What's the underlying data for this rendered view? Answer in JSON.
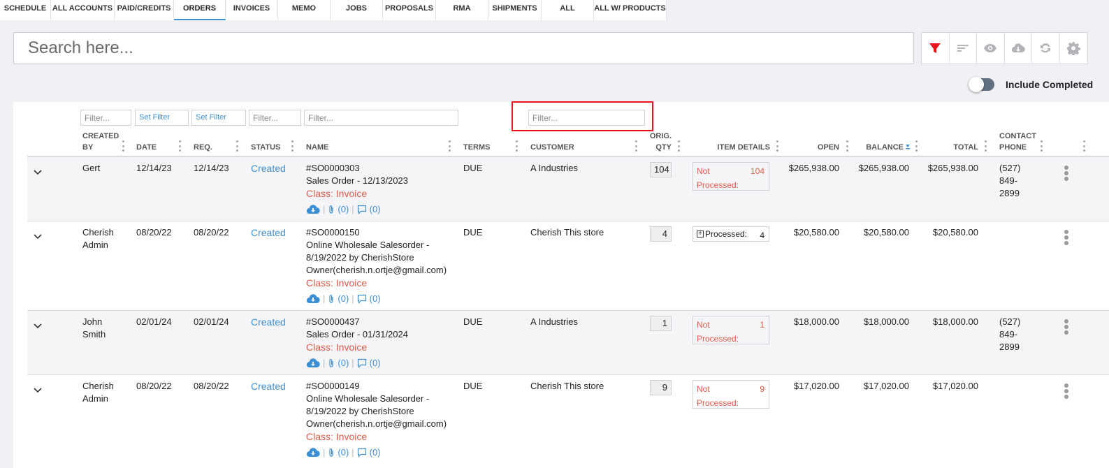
{
  "tabs": [
    {
      "label": "SCHEDULE",
      "active": false
    },
    {
      "label": "ALL ACCOUNTS",
      "active": false
    },
    {
      "label": "PAID/CREDITS",
      "active": false
    },
    {
      "label": "ORDERS",
      "active": true
    },
    {
      "label": "INVOICES",
      "active": false
    },
    {
      "label": "MEMO",
      "active": false
    },
    {
      "label": "JOBS",
      "active": false
    },
    {
      "label": "PROPOSALS",
      "active": false
    },
    {
      "label": "RMA",
      "active": false
    },
    {
      "label": "SHIPMENTS",
      "active": false
    },
    {
      "label": "ALL",
      "active": false
    },
    {
      "label": "ALL W/ PRODUCTS",
      "active": false
    }
  ],
  "search": {
    "placeholder": "Search here..."
  },
  "toolbar": {
    "icons": [
      "filter-icon",
      "sort-icon",
      "eye-icon",
      "cloud-download-icon",
      "refresh-icon",
      "gear-icon"
    ],
    "active_color": "#e8141c"
  },
  "toggle": {
    "label": "Include Completed",
    "on": false
  },
  "filters": {
    "created_by": "Filter...",
    "date": "Set Filter",
    "req": "Set Filter",
    "status": "Filter...",
    "name": "Filter...",
    "customer": "Filter..."
  },
  "columns": {
    "created_by": [
      "CREATED",
      "BY"
    ],
    "date": "DATE",
    "req": "REQ.",
    "status": "STATUS",
    "name": "NAME",
    "terms": "TERMS",
    "customer": "CUSTOMER",
    "orig_qty": [
      "ORIG.",
      "QTY"
    ],
    "item_details": "ITEM DETAILS",
    "open": "OPEN",
    "balance": "BALANCE",
    "total": "TOTAL",
    "contact_phone": [
      "CONTACT",
      "PHONE"
    ]
  },
  "rows": [
    {
      "created_by": [
        "Gert"
      ],
      "date": "12/14/23",
      "req": "12/14/23",
      "status": "Created",
      "order_no": "#SO0000303",
      "desc": [
        "Sales Order - 12/13/2023"
      ],
      "class": "Class: Invoice",
      "attachments": "(0)",
      "comments": "(0)",
      "terms": "DUE",
      "customer": "A Industries",
      "qty": "104",
      "item_label": [
        "Not",
        "Processed:"
      ],
      "item_count": "104",
      "processed": false,
      "open": "$265,938.00",
      "balance": "$265,938.00",
      "total": "$265,938.00",
      "phone": [
        "(527)",
        "849-",
        "2899"
      ]
    },
    {
      "created_by": [
        "Cherish",
        "Admin"
      ],
      "date": "08/20/22",
      "req": "08/20/22",
      "status": "Created",
      "order_no": "#SO0000150",
      "desc": [
        "Online Wholesale Salesorder -",
        "8/19/2022 by CherishStore",
        "Owner(cherish.n.ortje@gmail.com)"
      ],
      "class": "Class: Invoice",
      "attachments": "(0)",
      "comments": "(0)",
      "terms": "DUE",
      "customer": "Cherish This store",
      "qty": "4",
      "item_label": [
        "Processed:"
      ],
      "item_count": "4",
      "processed": true,
      "open": "$20,580.00",
      "balance": "$20,580.00",
      "total": "$20,580.00",
      "phone": []
    },
    {
      "created_by": [
        "John",
        "Smith"
      ],
      "date": "02/01/24",
      "req": "02/01/24",
      "status": "Created",
      "order_no": "#SO0000437",
      "desc": [
        "Sales Order - 01/31/2024"
      ],
      "class": "Class: Invoice",
      "attachments": "(0)",
      "comments": "(0)",
      "terms": "DUE",
      "customer": "A Industries",
      "qty": "1",
      "item_label": [
        "Not",
        "Processed:"
      ],
      "item_count": "1",
      "processed": false,
      "open": "$18,000.00",
      "balance": "$18,000.00",
      "total": "$18,000.00",
      "phone": [
        "(527)",
        "849-",
        "2899"
      ]
    },
    {
      "created_by": [
        "Cherish",
        "Admin"
      ],
      "date": "08/20/22",
      "req": "08/20/22",
      "status": "Created",
      "order_no": "#SO0000149",
      "desc": [
        "Online Wholesale Salesorder -",
        "8/19/2022 by CherishStore",
        "Owner(cherish.n.ortje@gmail.com)"
      ],
      "class": "Class: Invoice",
      "attachments": "(0)",
      "comments": "(0)",
      "terms": "DUE",
      "customer": "Cherish This store",
      "qty": "9",
      "item_label": [
        "Not",
        "Processed:"
      ],
      "item_count": "9",
      "processed": false,
      "open": "$17,020.00",
      "balance": "$17,020.00",
      "total": "$17,020.00",
      "phone": []
    }
  ]
}
